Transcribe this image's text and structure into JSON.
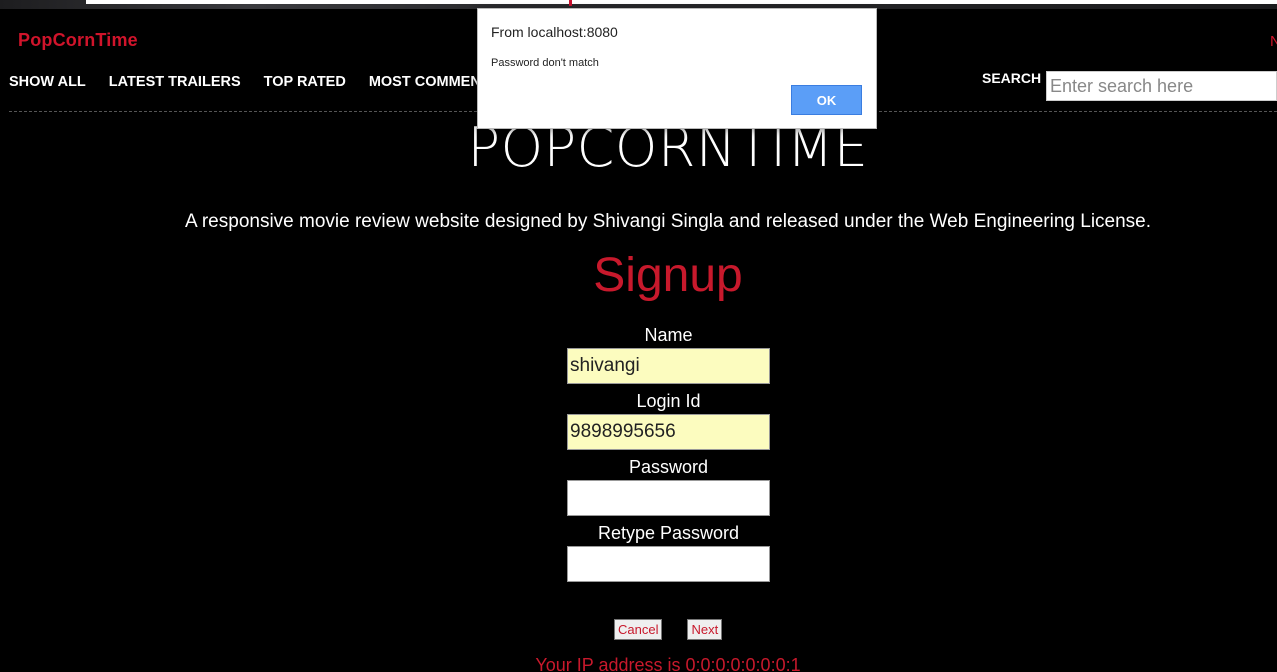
{
  "site": {
    "brand": "PopCornTime",
    "top_right_icon": "",
    "top_right_text": "N"
  },
  "nav": {
    "items": [
      "SHOW ALL",
      "LATEST TRAILERS",
      "TOP RATED",
      "MOST COMMENTED"
    ],
    "search_label": "SEARCH",
    "search_placeholder": "Enter search here"
  },
  "hero": {
    "title": "POPCORNTIME",
    "tagline": "A responsive movie review website designed by Shivangi Singla and released under the Web Engineering License."
  },
  "signup": {
    "heading": "Signup",
    "fields": [
      {
        "label": "Name",
        "value": "shivangi"
      },
      {
        "label": "Login Id",
        "value": "9898995656"
      },
      {
        "label": "Password",
        "value": ""
      },
      {
        "label": "Retype Password",
        "value": ""
      }
    ],
    "cancel_label": "Cancel",
    "next_label": "Next",
    "ip_text": "Your IP address is 0:0:0:0:0:0:0:1"
  },
  "dialog": {
    "origin": "From localhost:8080",
    "message": "Password don't match",
    "ok_label": "OK"
  },
  "colors": {
    "accent": "#c8192c",
    "background": "#000000",
    "autofill": "#fcfcbf",
    "dialog_button": "#5b9ef7"
  }
}
